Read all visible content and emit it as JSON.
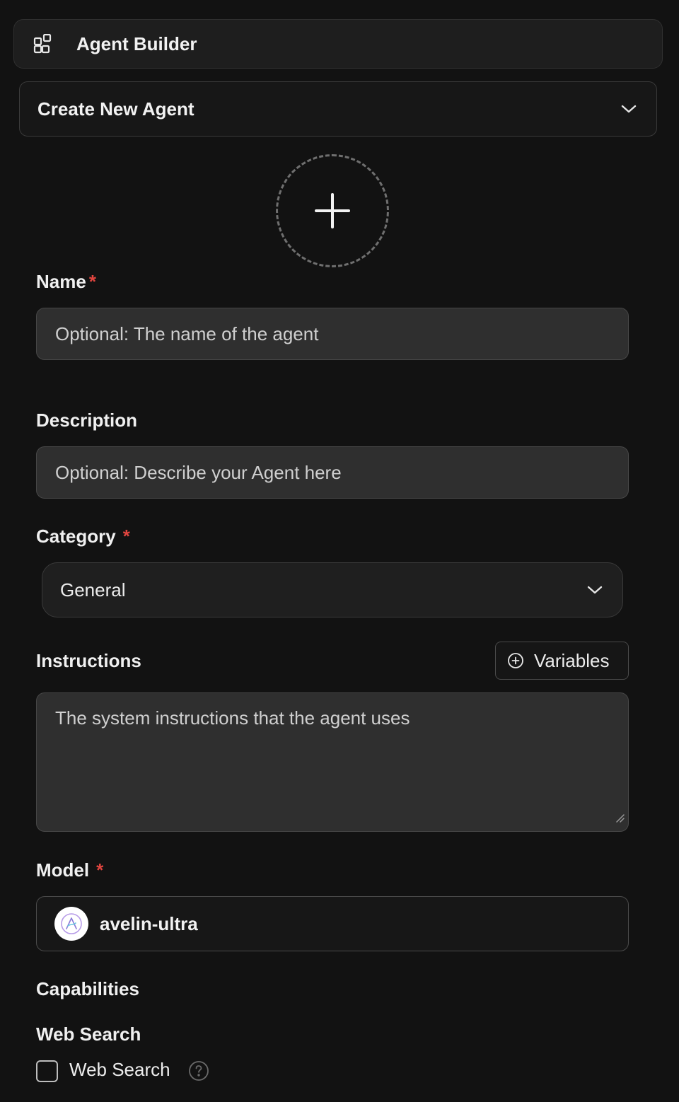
{
  "header": {
    "icon": "widgets-icon",
    "title": "Agent Builder"
  },
  "agent_select": {
    "value": "Create New Agent",
    "icon": "chevron-down-icon"
  },
  "avatar_upload": {
    "icon": "plus-icon"
  },
  "form": {
    "name": {
      "label": "Name",
      "required_mark": "*",
      "placeholder": "Optional: The name of the agent"
    },
    "description": {
      "label": "Description",
      "placeholder": "Optional: Describe your Agent here"
    },
    "category": {
      "label": "Category",
      "required_mark": "*",
      "value": "General"
    },
    "instructions": {
      "label": "Instructions",
      "variables_button": "Variables",
      "placeholder": "The system instructions that the agent uses"
    },
    "model": {
      "label": "Model",
      "required_mark": "*",
      "value": "avelin-ultra"
    },
    "capabilities": {
      "label": "Capabilities",
      "web_search": {
        "section_label": "Web Search",
        "checkbox_label": "Web Search",
        "checked": false,
        "help_icon": "question-circle-icon"
      }
    }
  },
  "colors": {
    "background": "#121212",
    "input_bg": "#2f2f2f",
    "required": "#e0453f"
  }
}
